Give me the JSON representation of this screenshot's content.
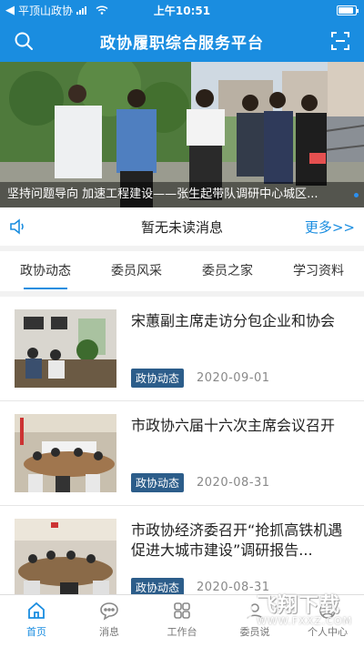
{
  "status_bar": {
    "back_app": "平顶山政协",
    "time": "上午10:51",
    "battery_level": 0.9
  },
  "header": {
    "title": "政协履职综合服务平台",
    "left_icon": "search-icon",
    "right_icon": "scan-icon"
  },
  "banner": {
    "caption": "坚持问题导向 加速工程建设——张生起带队调研中心城区..."
  },
  "notice": {
    "text": "暂无未读消息",
    "more_label": "更多>>",
    "icon": "speaker-icon"
  },
  "tabs": [
    {
      "label": "政协动态",
      "active": true
    },
    {
      "label": "委员风采",
      "active": false
    },
    {
      "label": "委员之家",
      "active": false
    },
    {
      "label": "学习资料",
      "active": false
    }
  ],
  "news": [
    {
      "title": "宋蕙副主席走访分包企业和协会",
      "tag": "政协动态",
      "date": "2020-09-01"
    },
    {
      "title": "市政协六届十六次主席会议召开",
      "tag": "政协动态",
      "date": "2020-08-31"
    },
    {
      "title": "市政协经济委召开“抢抓高铁机遇 促进大城市建设”调研报告...",
      "tag": "政协动态",
      "date": "2020-08-31"
    }
  ],
  "bottom_nav": [
    {
      "label": "首页",
      "icon": "home-icon",
      "active": true
    },
    {
      "label": "消息",
      "icon": "message-icon",
      "active": false
    },
    {
      "label": "工作台",
      "icon": "grid-icon",
      "active": false
    },
    {
      "label": "委员说",
      "icon": "user-icon",
      "active": false
    },
    {
      "label": "个人中心",
      "icon": "profile-icon",
      "active": false
    }
  ],
  "watermark": {
    "main": "飞翔下载",
    "sub": "WWW.FXXZ.COM"
  },
  "colors": {
    "primary": "#1a8de0",
    "tag_bg": "#2c5d8a"
  }
}
